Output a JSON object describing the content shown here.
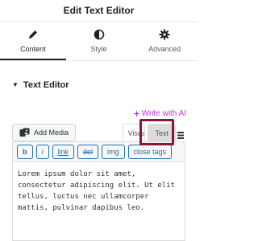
{
  "panel": {
    "title": "Edit Text Editor"
  },
  "tabs": [
    {
      "label": "Content",
      "icon": "pencil-icon",
      "active": true
    },
    {
      "label": "Style",
      "icon": "half-circle-icon",
      "active": false
    },
    {
      "label": "Advanced",
      "icon": "gear-icon",
      "active": false
    }
  ],
  "section": {
    "title": "Text Editor",
    "caret_icon": "caret-down-icon"
  },
  "ai": {
    "label": "Write with AI",
    "color": "#c036d6"
  },
  "editor": {
    "add_media_label": "Add Media",
    "mode_visual": "Visual",
    "mode_text": "Text",
    "highlight_color": "#8b1538",
    "quicktags": [
      "b",
      "i",
      "link",
      "del",
      "img",
      "close tags"
    ],
    "content": "Lorem ipsum dolor sit amet, consectetur adipiscing elit. Ut elit tellus, luctus nec ullamcorper mattis, pulvinar dapibus leo."
  }
}
